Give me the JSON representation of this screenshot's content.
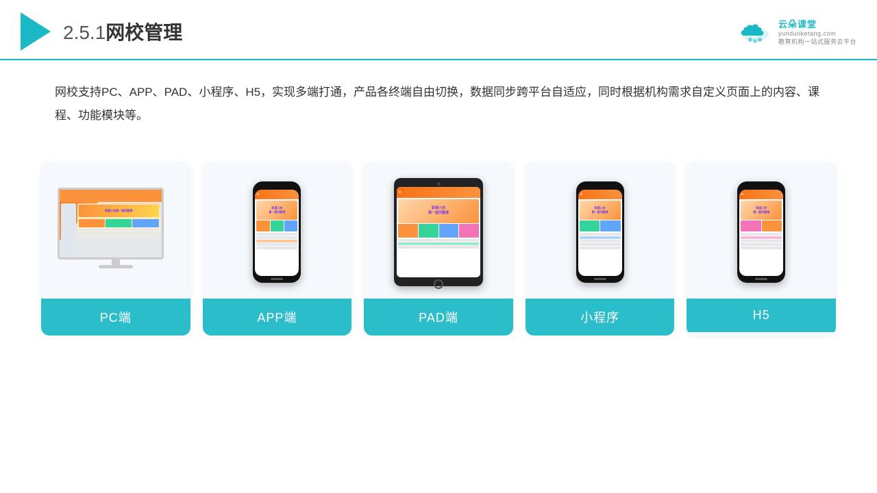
{
  "header": {
    "title": "2.5.1网校管理",
    "title_num": "2.5.1",
    "title_text": "网校管理"
  },
  "logo": {
    "name": "云朵课堂",
    "url": "yunduoketang.com",
    "tagline": "教育机构一站式服务云平台"
  },
  "description": {
    "text": "网校支持PC、APP、PAD、小程序、H5，实现多端打通，产品各终端自由切换，数据同步跨平台自适应，同时根据机构需求自定义页面上的内容、课程、功能模块等。"
  },
  "cards": [
    {
      "id": "pc",
      "label": "PC端"
    },
    {
      "id": "app",
      "label": "APP端"
    },
    {
      "id": "pad",
      "label": "PAD端"
    },
    {
      "id": "miniprogram",
      "label": "小程序"
    },
    {
      "id": "h5",
      "label": "H5"
    }
  ]
}
